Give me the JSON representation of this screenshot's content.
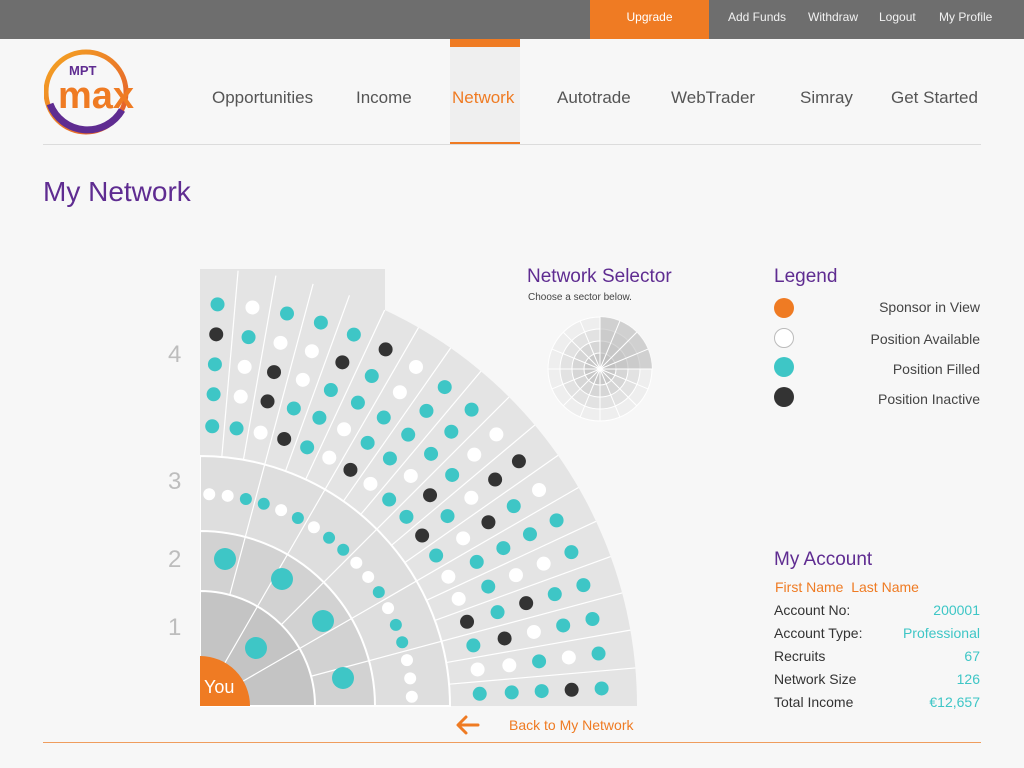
{
  "topbar": {
    "upgrade": "Upgrade",
    "links": [
      "Add Funds",
      "Withdraw",
      "Logout",
      "My Profile"
    ]
  },
  "logo": {
    "small_text": "MPT",
    "big_text": "max"
  },
  "nav": {
    "items": [
      "Opportunities",
      "Income",
      "Network",
      "Autotrade",
      "WebTrader",
      "Simray",
      "Get Started"
    ],
    "active": "Network"
  },
  "page": {
    "title": "My Network"
  },
  "network": {
    "levels": [
      "1",
      "2",
      "3",
      "4"
    ],
    "center_label": "You"
  },
  "selector": {
    "title": "Network Selector",
    "subtitle": "Choose a sector below."
  },
  "legend": {
    "title": "Legend",
    "items": [
      {
        "label": "Sponsor in View",
        "color": "#ef7b23",
        "kind": "sponsor"
      },
      {
        "label": "Position Available",
        "color": "#ffffff",
        "kind": "available"
      },
      {
        "label": "Position Filled",
        "color": "#3ec6c6",
        "kind": "filled"
      },
      {
        "label": "Position Inactive",
        "color": "#333333",
        "kind": "inactive"
      }
    ]
  },
  "account": {
    "title": "My Account",
    "name": "First Name  Last Name",
    "rows": [
      {
        "key": "Account No:",
        "value": "200001"
      },
      {
        "key": "Account Type:",
        "value": "Professional"
      },
      {
        "key": "Recruits",
        "value": "67"
      },
      {
        "key": "Network Size",
        "value": "126"
      },
      {
        "key": "Total Income",
        "value": "€12,657"
      }
    ]
  },
  "back": {
    "label": "Back to My Network"
  },
  "colors": {
    "accent": "#ef7b23",
    "brand_purple": "#5f2c91",
    "filled": "#3ec6c6",
    "inactive": "#333333",
    "available": "#ffffff"
  }
}
